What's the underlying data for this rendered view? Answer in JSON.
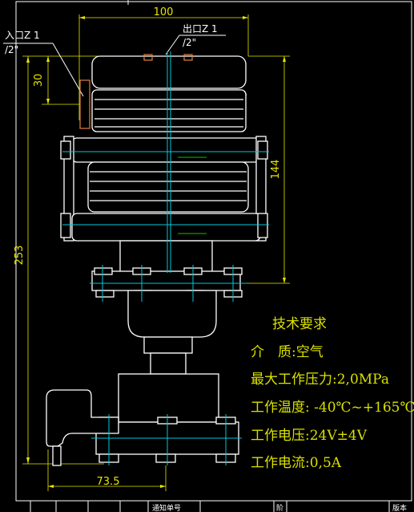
{
  "dimensions": {
    "width_top": "100",
    "height_total": "253",
    "height_body": "144",
    "inlet_offset": "30",
    "base_width": "73.5"
  },
  "ports": {
    "inlet_line1": "入口Z 1",
    "inlet_line2": "/2\"",
    "outlet_line1": "出口Z 1",
    "outlet_line2": "/2\""
  },
  "requirements": {
    "title": "技术要求",
    "medium": "介　质:空气",
    "max_pressure": "最大工作压力:2,0MPa",
    "temperature": "工作温度: -40℃~+165℃",
    "voltage": "工作电压:24V±4V",
    "current": "工作电流:0,5A"
  },
  "title_block": {
    "cell_1": "通知单号",
    "cell_2": "阶",
    "cell_3": "版本"
  },
  "colors": {
    "background": "#000000",
    "outline": "#ffffff",
    "centerline": "#00c8d8",
    "dimension": "#e6e600",
    "text": "#d8e000"
  }
}
